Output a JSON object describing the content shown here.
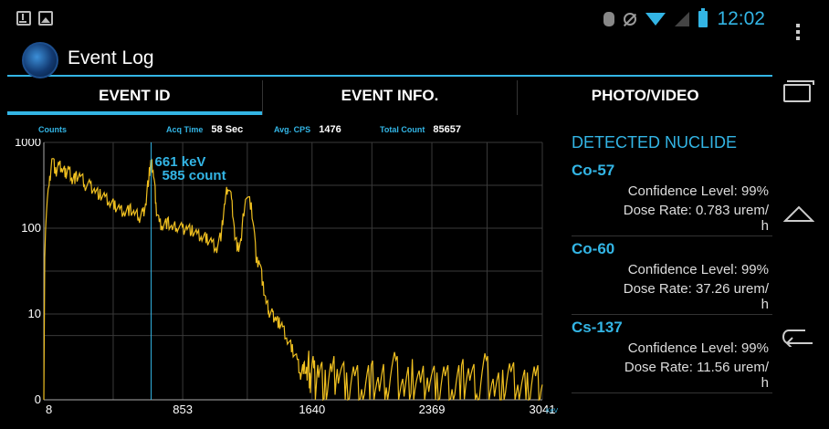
{
  "statusbar": {
    "time": "12:02",
    "icons": [
      "download-icon",
      "image-icon",
      "bluetooth-icon",
      "mute-icon",
      "wifi-icon",
      "signal-icon",
      "battery-icon"
    ],
    "accent": "#33b5e5"
  },
  "app": {
    "title": "Event Log",
    "icon": "app-logo-icon"
  },
  "tabs": [
    {
      "label": "EVENT ID",
      "active": true
    },
    {
      "label": "EVENT INFO.",
      "active": false
    },
    {
      "label": "PHOTO/VIDEO",
      "active": false
    }
  ],
  "graph_header": {
    "counts_label": "Counts",
    "acq_time_label": "Acq Time",
    "acq_time_value": "58 Sec",
    "avg_cps_label": "Avg. CPS",
    "avg_cps_value": "1476",
    "total_count_label": "Total Count",
    "total_count_value": "85657"
  },
  "chart_data": {
    "type": "line",
    "xlabel": "KeV",
    "ylabel": "Counts",
    "x_ticks": [
      "8",
      "853",
      "1640",
      "2369",
      "3041"
    ],
    "y_ticks": [
      "1000",
      "100",
      "10",
      "0"
    ],
    "xlim": [
      8,
      3041
    ],
    "ylim": [
      1,
      1000
    ],
    "yscale": "log",
    "grid": true,
    "line_color": "#f0c020",
    "marker": {
      "x": 661,
      "energy_label": "661 keV",
      "count_label": "585 count",
      "color": "#33b5e5"
    },
    "series": [
      {
        "x": [
          8,
          40,
          60,
          80,
          100,
          120,
          140,
          160,
          180,
          200,
          230,
          260,
          290,
          320,
          350,
          380,
          410,
          440,
          470,
          500,
          530,
          560,
          590,
          610,
          630,
          650,
          661,
          675,
          690,
          710,
          730,
          760,
          790,
          820,
          850,
          880,
          910,
          940,
          970,
          1000,
          1030,
          1060,
          1090,
          1110,
          1130,
          1150,
          1170,
          1190,
          1210,
          1240,
          1270,
          1300,
          1320,
          1340,
          1360,
          1380,
          1400,
          1420,
          1440,
          1460,
          1490,
          1520,
          1550,
          1570,
          1590,
          1610,
          1630,
          1650,
          1680,
          1720,
          1760,
          1800,
          1850,
          1900,
          1950,
          2000,
          2050,
          2100,
          2150,
          2200,
          2250,
          2300,
          2350,
          2400,
          2450,
          2500,
          2550,
          2600,
          2650,
          2700,
          2750,
          2800,
          2850,
          2900,
          2950,
          3000,
          3041
        ],
        "y": [
          1,
          300,
          700,
          450,
          550,
          500,
          450,
          500,
          380,
          400,
          420,
          330,
          320,
          280,
          250,
          230,
          200,
          190,
          170,
          160,
          170,
          150,
          140,
          150,
          200,
          450,
          585,
          450,
          180,
          120,
          110,
          120,
          100,
          110,
          100,
          105,
          95,
          85,
          80,
          78,
          70,
          60,
          90,
          200,
          330,
          210,
          80,
          60,
          70,
          250,
          180,
          40,
          45,
          22,
          14,
          11,
          10,
          9,
          8,
          7,
          5,
          4,
          3,
          2,
          2.5,
          2,
          3,
          2,
          2.5,
          1.5,
          2,
          2.5,
          1.5,
          2,
          1.5,
          2,
          1.5,
          2,
          2.5,
          1.5,
          2,
          1.5,
          2,
          1.5,
          2,
          1.5,
          2,
          2,
          1.5,
          2.5,
          1.5,
          1.5,
          2,
          1.5,
          1.5,
          2,
          1.5
        ]
      }
    ]
  },
  "panel": {
    "title": "DETECTED NUCLIDE",
    "nuclides": [
      {
        "name": "Co-57",
        "confidence": "Confidence Level: 99%",
        "dose_line1": "Dose Rate: 0.783 urem/",
        "dose_line2": "h"
      },
      {
        "name": "Co-60",
        "confidence": "Confidence Level: 99%",
        "dose_line1": "Dose Rate: 37.26 urem/",
        "dose_line2": "h"
      },
      {
        "name": "Cs-137",
        "confidence": "Confidence Level: 99%",
        "dose_line1": "Dose Rate: 11.56 urem/",
        "dose_line2": "h"
      }
    ]
  },
  "navbar": {
    "icons": [
      "overflow-menu-icon",
      "recent-apps-icon",
      "home-icon",
      "back-icon"
    ]
  }
}
